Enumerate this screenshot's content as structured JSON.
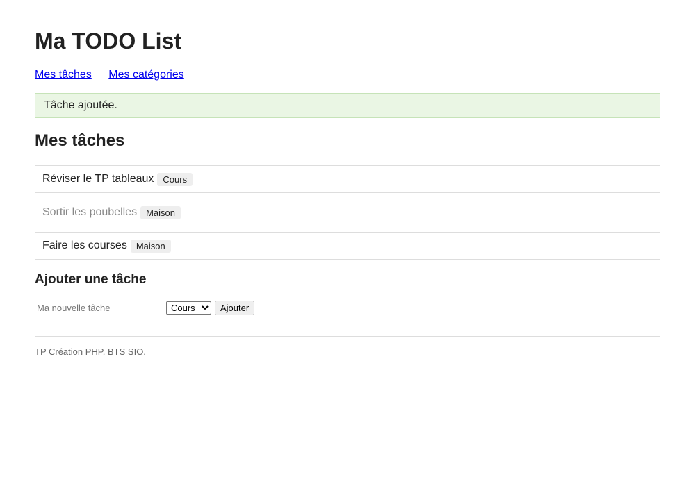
{
  "header": {
    "title": "Ma TODO List"
  },
  "nav": {
    "items": [
      {
        "label": "Mes tâches"
      },
      {
        "label": "Mes catégories"
      }
    ]
  },
  "flash": {
    "message": "Tâche ajoutée."
  },
  "tasks_section": {
    "title": "Mes tâches",
    "items": [
      {
        "text": "Réviser le TP tableaux",
        "category": "Cours",
        "done": false
      },
      {
        "text": "Sortir les poubelles",
        "category": "Maison",
        "done": true
      },
      {
        "text": "Faire les courses",
        "category": "Maison",
        "done": false
      }
    ]
  },
  "add_form": {
    "title": "Ajouter une tâche",
    "input_placeholder": "Ma nouvelle tâche",
    "input_value": "",
    "select_value": "Cours",
    "submit_label": "Ajouter"
  },
  "footer": {
    "text": "TP Création PHP, BTS SIO."
  }
}
